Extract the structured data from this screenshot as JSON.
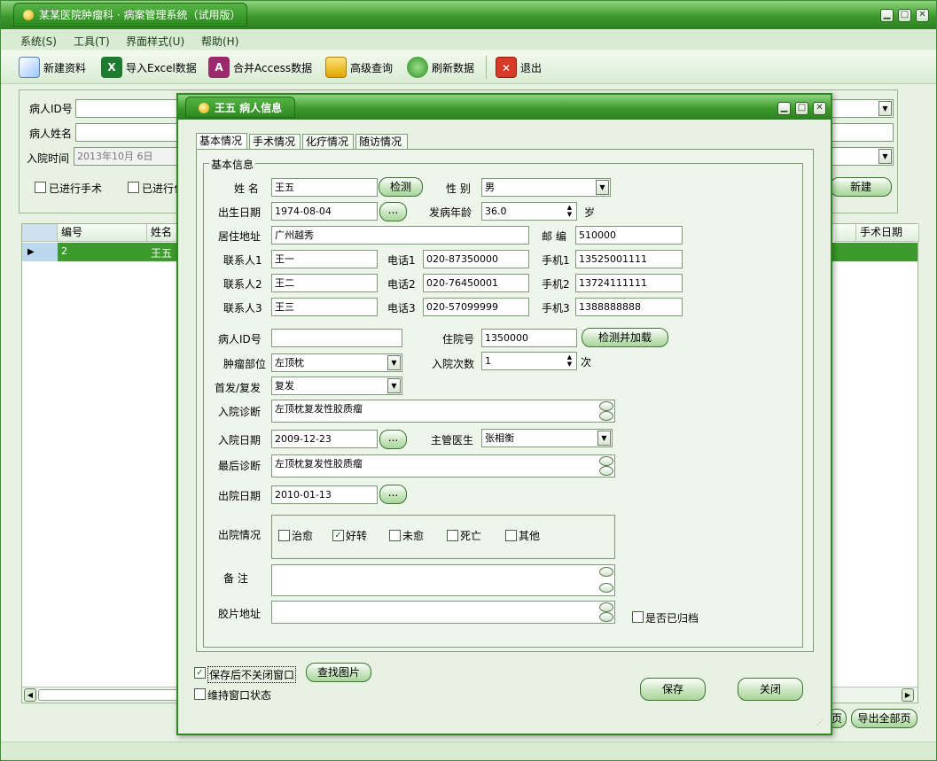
{
  "main_window": {
    "title": "某某医院肿瘤科 · 病案管理系统（试用版）",
    "menu": [
      "系统(S)",
      "工具(T)",
      "界面样式(U)",
      "帮助(H)"
    ],
    "toolbar": {
      "new": "新建资料",
      "import_excel": "导入Excel数据",
      "merge_access": "合并Access数据",
      "advanced_query": "高级查询",
      "refresh": "刷新数据",
      "exit": "退出"
    },
    "search": {
      "patient_id_label": "病人ID号",
      "patient_name_label": "病人姓名",
      "admit_time_label": "入院时间",
      "admit_date_value": "2013年10月  6日",
      "surgery_checkbox": "已进行手术",
      "chemo_checkbox_partial": "已进行化",
      "new_button": "新建"
    },
    "grid": {
      "columns": [
        "编号",
        "姓名",
        "手术日期"
      ],
      "rows": [
        {
          "id": "2",
          "name": "王五"
        }
      ]
    },
    "export_partial": "页",
    "export_all": "导出全部页"
  },
  "dialog": {
    "title": "王五 病人信息",
    "tabs": [
      "基本情况",
      "手术情况",
      "化疗情况",
      "随访情况"
    ],
    "group_title": "基本信息",
    "name_label": "姓  名",
    "name": "王五",
    "check_btn": "检测",
    "gender_label": "性  别",
    "gender": "男",
    "birth_label": "出生日期",
    "birth": "1974-08-04",
    "ellipsis": "...",
    "onset_age_label": "发病年龄",
    "onset_age": "36.0",
    "age_unit": "岁",
    "address_label": "居住地址",
    "address": "广州越秀",
    "postcode_label": "邮  编",
    "postcode": "510000",
    "contacts": [
      {
        "label": "联系人1",
        "name": "王一",
        "tel_label": "电话1",
        "tel": "020-87350000",
        "mobile_label": "手机1",
        "mobile": "13525001111"
      },
      {
        "label": "联系人2",
        "name": "王二",
        "tel_label": "电话2",
        "tel": "020-76450001",
        "mobile_label": "手机2",
        "mobile": "13724111111"
      },
      {
        "label": "联系人3",
        "name": "王三",
        "tel_label": "电话3",
        "tel": "020-57099999",
        "mobile_label": "手机3",
        "mobile": "1388888888"
      }
    ],
    "pid_label": "病人ID号",
    "pid": "",
    "hosp_no_label": "住院号",
    "hosp_no": "1350000",
    "check_load_btn": "检测并加载",
    "tumor_site_label": "肿瘤部位",
    "tumor_site": "左顶枕",
    "admit_times_label": "入院次数",
    "admit_times": "1",
    "times_unit": "次",
    "first_recur_label": "首发/复发",
    "first_recur": "复发",
    "admit_diag_label": "入院诊断",
    "admit_diag": "左顶枕复发性胶质瘤",
    "admit_date_label": "入院日期",
    "admit_date": "2009-12-23",
    "doctor_label": "主管医生",
    "doctor": "张相衡",
    "final_diag_label": "最后诊断",
    "final_diag": "左顶枕复发性胶质瘤",
    "discharge_date_label": "出院日期",
    "discharge_date": "2010-01-13",
    "discharge_status_label": "出院情况",
    "discharge_options": [
      {
        "label": "治愈",
        "checked": false
      },
      {
        "label": "好转",
        "checked": true
      },
      {
        "label": "未愈",
        "checked": false
      },
      {
        "label": "死亡",
        "checked": false
      },
      {
        "label": "其他",
        "checked": false
      }
    ],
    "remarks_label": "备  注",
    "remarks": "",
    "film_label": "胶片地址",
    "film": "",
    "archived_label": "是否已归档",
    "keep_open_label": "保存后不关闭窗口",
    "keep_state_label": "维持窗口状态",
    "find_image_btn": "查找图片",
    "save_btn": "保存",
    "close_btn": "关闭"
  }
}
